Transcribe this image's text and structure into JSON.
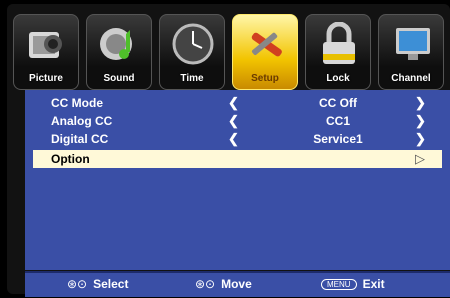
{
  "tabs": [
    {
      "label": "Picture",
      "icon": "camera-icon"
    },
    {
      "label": "Sound",
      "icon": "speaker-icon"
    },
    {
      "label": "Time",
      "icon": "clock-icon"
    },
    {
      "label": "Setup",
      "icon": "tools-icon"
    },
    {
      "label": "Lock",
      "icon": "padlock-icon"
    },
    {
      "label": "Channel",
      "icon": "monitor-icon"
    }
  ],
  "rows": [
    {
      "name": "CC Mode",
      "value": "CC Off",
      "left": "❮",
      "right": "❯"
    },
    {
      "name": "Analog CC",
      "value": "CC1",
      "left": "❮",
      "right": "❯"
    },
    {
      "name": "Digital CC",
      "value": "Service1",
      "left": "❮",
      "right": "❯"
    },
    {
      "name": "Option",
      "value": "",
      "left": "",
      "right": "▷"
    }
  ],
  "footer": {
    "select_icon": "⊛⊙",
    "select": "Select",
    "move_icon": "⊛⊙",
    "move": "Move",
    "menu_key": "MENU",
    "exit": "Exit"
  },
  "colors": {
    "panel": "#3a4fa6",
    "active_tab": "#f2c400",
    "selected_row": "#fff9d8"
  }
}
